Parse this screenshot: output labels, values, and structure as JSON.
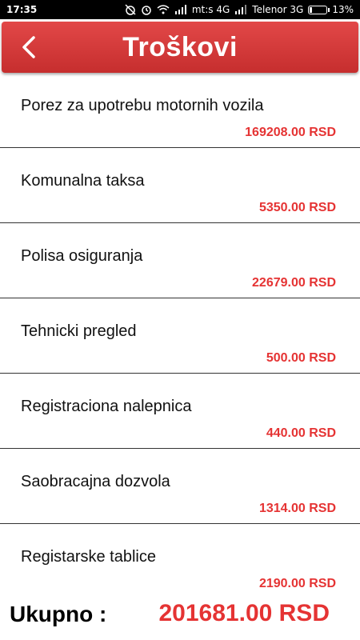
{
  "status_bar": {
    "time": "17:35",
    "carrier1": "mt:s 4G",
    "carrier2": "Telenor 3G",
    "battery": "13%",
    "icons": [
      "alarm-off-icon",
      "alarm-icon",
      "wifi-icon",
      "signal-icon",
      "battery-icon"
    ]
  },
  "header": {
    "title": "Troškovi",
    "back_icon": "chevron-left-icon",
    "color": "#d63a3a"
  },
  "items": [
    {
      "label": "Porez za upotrebu motornih vozila",
      "amount": "169208.00 RSD"
    },
    {
      "label": "Komunalna taksa",
      "amount": "5350.00 RSD"
    },
    {
      "label": "Polisa osiguranja",
      "amount": "22679.00 RSD"
    },
    {
      "label": "Tehnicki pregled",
      "amount": "500.00 RSD"
    },
    {
      "label": "Registraciona nalepnica",
      "amount": "440.00 RSD"
    },
    {
      "label": "Saobracajna dozvola",
      "amount": "1314.00 RSD"
    },
    {
      "label": "Registarske tablice",
      "amount": "2190.00 RSD"
    }
  ],
  "total": {
    "label": "Ukupno :",
    "value": "201681.00 RSD"
  },
  "accent_color": "#e53333"
}
